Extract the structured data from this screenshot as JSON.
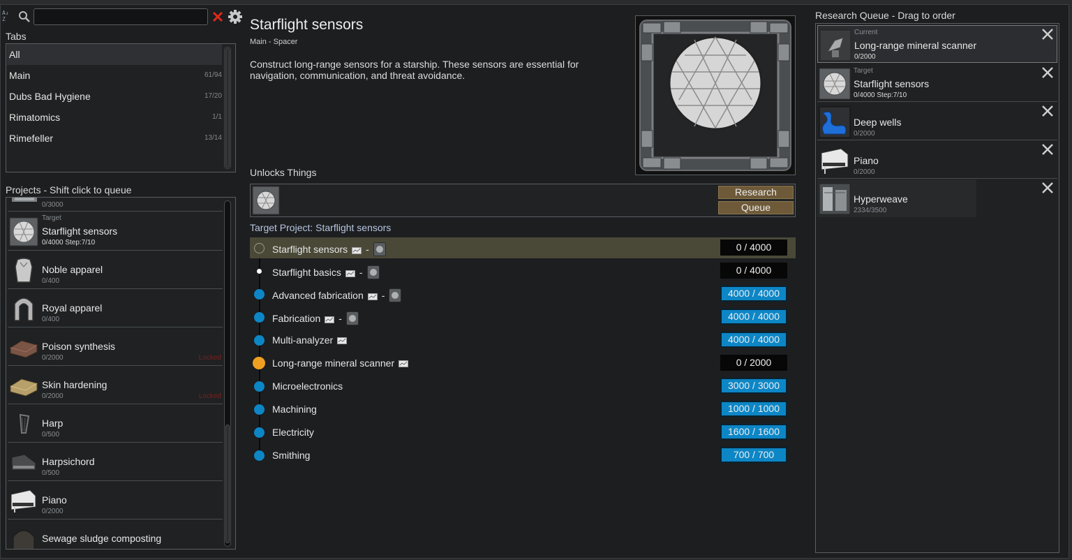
{
  "search": {
    "value": "",
    "placeholder": ""
  },
  "tabs": {
    "label": "Tabs",
    "items": [
      {
        "label": "All",
        "count": ""
      },
      {
        "label": "Main",
        "count": "61/94"
      },
      {
        "label": "Dubs Bad Hygiene",
        "count": "17/20"
      },
      {
        "label": "Rimatomics",
        "count": "1/1"
      },
      {
        "label": "Rimefeller",
        "count": "13/14"
      }
    ]
  },
  "projects": {
    "label": "Projects - Shift click to queue",
    "partial_top_progress": "0/3000",
    "items": [
      {
        "tag": "Target",
        "name": "Starflight sensors",
        "progress": "0/4000 Step:7/10",
        "locked": ""
      },
      {
        "tag": "",
        "name": "Noble apparel",
        "progress": "0/400",
        "locked": ""
      },
      {
        "tag": "",
        "name": "Royal apparel",
        "progress": "0/400",
        "locked": ""
      },
      {
        "tag": "",
        "name": "Poison synthesis",
        "progress": "0/2000",
        "locked": "Locked"
      },
      {
        "tag": "",
        "name": "Skin hardening",
        "progress": "0/2000",
        "locked": "Locked"
      },
      {
        "tag": "",
        "name": "Harp",
        "progress": "0/500",
        "locked": ""
      },
      {
        "tag": "",
        "name": "Harpsichord",
        "progress": "0/500",
        "locked": ""
      },
      {
        "tag": "",
        "name": "Piano",
        "progress": "0/2000",
        "locked": ""
      },
      {
        "tag": "",
        "name": "Sewage sludge composting",
        "progress": "",
        "locked": ""
      }
    ]
  },
  "detail": {
    "title": "Starflight sensors",
    "subtitle": "Main - Spacer",
    "description": "Construct long-range sensors for a starship. These sensors are essential for navigation, communication, and threat avoidance.",
    "unlocks_label": "Unlocks Things",
    "research_button": "Research",
    "queue_button": "Queue",
    "target_label": "Target Project: Starflight sensors",
    "separator": "-",
    "requirements": [
      {
        "name": "Starflight sensors",
        "value": "0 / 4000",
        "state": "target"
      },
      {
        "name": "Starflight basics",
        "value": "0 / 4000",
        "state": "pending"
      },
      {
        "name": "Advanced fabrication",
        "value": "4000 / 4000",
        "state": "done"
      },
      {
        "name": "Fabrication",
        "value": "4000 / 4000",
        "state": "done"
      },
      {
        "name": "Multi-analyzer",
        "value": "4000 / 4000",
        "state": "done"
      },
      {
        "name": "Long-range mineral scanner",
        "value": "0 / 2000",
        "state": "current"
      },
      {
        "name": "Microelectronics",
        "value": "3000 / 3000",
        "state": "done"
      },
      {
        "name": "Machining",
        "value": "1000 / 1000",
        "state": "done"
      },
      {
        "name": "Electricity",
        "value": "1600 / 1600",
        "state": "done"
      },
      {
        "name": "Smithing",
        "value": "700 / 700",
        "state": "done"
      }
    ]
  },
  "queue": {
    "label": "Research Queue - Drag to order",
    "items": [
      {
        "tag": "Current",
        "name": "Long-range mineral scanner",
        "progress": "0/2000"
      },
      {
        "tag": "Target",
        "name": "Starflight sensors",
        "progress": "0/4000 Step:7/10"
      },
      {
        "tag": "",
        "name": "Deep wells",
        "progress": "0/2000"
      },
      {
        "tag": "",
        "name": "Piano",
        "progress": "0/2000"
      },
      {
        "tag": "",
        "name": "Hyperweave",
        "progress": "2334/3500"
      }
    ]
  },
  "colors": {
    "done": "#0d86c6",
    "current": "#f0a020",
    "locked": "#7a2020",
    "button": "#6e5a39",
    "highlight": "#4a4938"
  }
}
